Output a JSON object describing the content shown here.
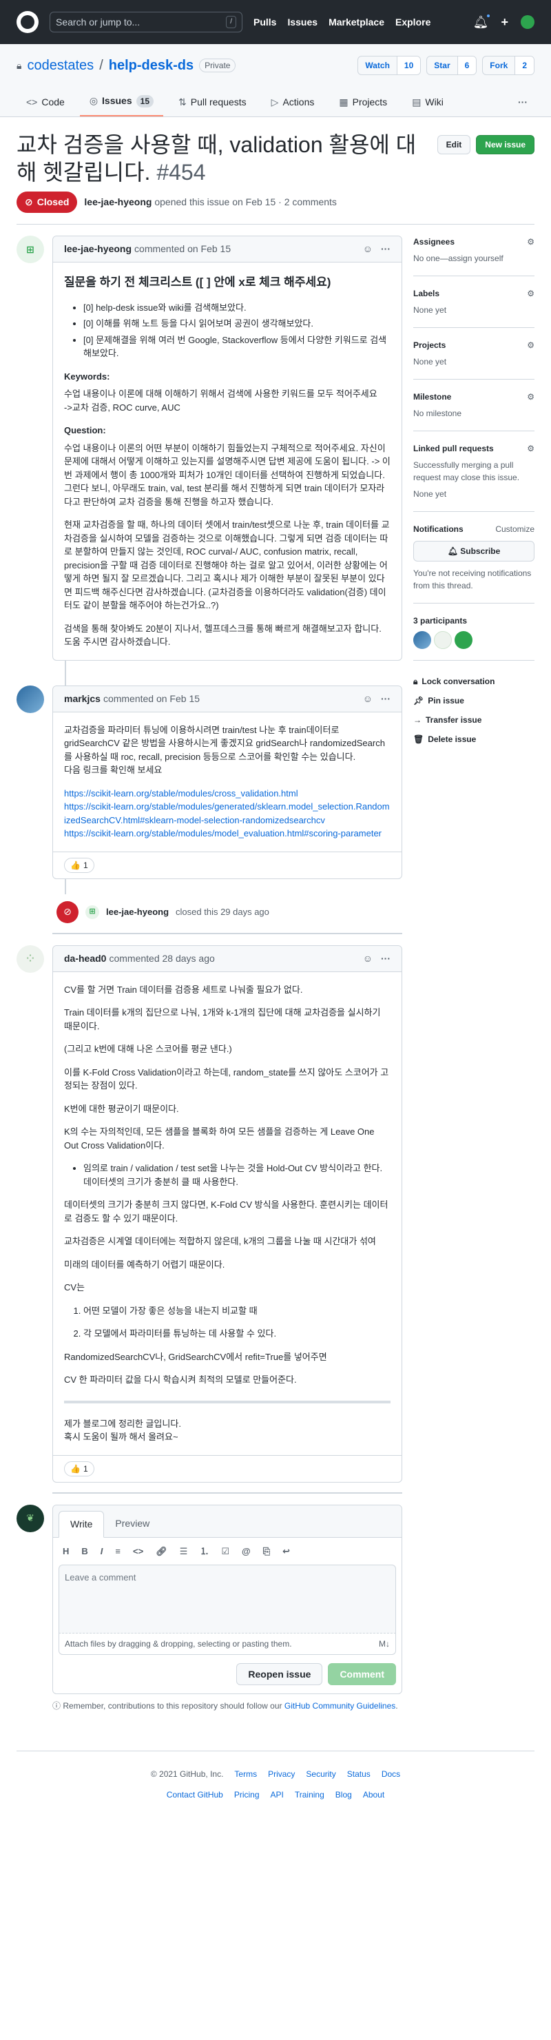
{
  "header": {
    "search_placeholder": "Search or jump to...",
    "slash": "/",
    "nav": [
      "Pulls",
      "Issues",
      "Marketplace",
      "Explore"
    ],
    "plus": "+"
  },
  "repo": {
    "owner": "codestates",
    "name": "help-desk-ds",
    "visibility": "Private",
    "watch_label": "Watch",
    "watch_count": "10",
    "star_label": "Star",
    "star_count": "6",
    "fork_label": "Fork",
    "fork_count": "2"
  },
  "tabs": {
    "code": "Code",
    "issues": "Issues",
    "issues_count": "15",
    "pulls": "Pull requests",
    "actions": "Actions",
    "projects": "Projects",
    "wiki": "Wiki"
  },
  "issue": {
    "title": "교차 검증을 사용할 때, validation 활용에 대해 헷갈립니다.",
    "number": "#454",
    "edit": "Edit",
    "new_issue": "New issue",
    "status": "Closed",
    "author": "lee-jae-hyeong",
    "opened_text": "opened this issue on Feb 15 · 2 comments"
  },
  "comments": [
    {
      "author": "lee-jae-hyeong",
      "time": "commented on Feb 15",
      "heading": "질문을 하기 전 체크리스트 ([ ] 안에 x로 체크 해주세요)",
      "checklist": [
        "[0] help-desk issue와 wiki를 검색해보았다.",
        "[0] 이해를 위해 노트 등을 다시 읽어보며 공권이 생각해보았다.",
        "[0] 문제해결을 위해 여러 번 Google, Stackoverflow 등에서 다양한 키워드로 검색해보았다."
      ],
      "kw_label": "Keywords:",
      "kw_text1": "수업 내용이나 이론에 대해 이해하기 위해서 검색에 사용한 키워드를 모두 적어주세요",
      "kw_text2": "->교차 검증, ROC curve, AUC",
      "q_label": "Question:",
      "q_p1": "수업 내용이나 이론의 어떤 부분이 이해하기 힘들었는지 구체적으로 적어주세요. 자신이 문제에 대해서 어떻게 이해하고 있는지를 설명해주시면 답변 제공에 도움이 됩니다. -> 이번 과제에서 행이 총 1000개와 피처가 10개인 데이터를 선택하여 진행하게 되었습니다. 그런다 보니, 아무래도 train, val, test 분리를 해서 진행하게 되면 train 데이터가 모자라다고 판단하여 교차 검증을 통해 진행을 하고자 했습니다.",
      "q_p2": "현재 교차검증을 할 때, 하나의 데이터 셋에서 train/test셋으로 나눈 후, train 데이터를 교차검증을 실시하여 모델을 검증하는 것으로 이해했습니다. 그렇게 되면 검증 데이터는 따로 분할하여 만들지 않는 것인데, ROC curval-/ AUC, confusion matrix, recall, precision을 구할 때 검증 데이터로 진행해야 하는 걸로 알고 있어서, 이러한 상황에는 어떻게 하면 될지 잘 모르겠습니다. 그리고 혹시나 제가 이해한 부분이 잘못된 부분이 있다면 피드백 해주신다면 감사하겠습니다. (교차검증을 이용하더라도 validation(검증) 데이터도 같이 분할을 해주어야 하는건가요..?)",
      "q_p3": "검색을 통해 찾아봐도 20분이 지나서, 헬프데스크를 통해 빠르게 해결해보고자 합니다. 도움 주시면 감사하겠습니다."
    },
    {
      "author": "markjcs",
      "time": "commented on Feb 15",
      "p1": "교차검증을 파라미터 튜닝에 이용하시려면 train/test 나눈 후 train데이터로 gridSearchCV 같은 방법을 사용하시는게 좋겠지요 gridSearch나 randomizedSearch 를 사용하실 때 roc, recall, precision 등등으로 스코어를 확인할 수는 있습니다.",
      "p2": "다음 링크를 확인해 보세요",
      "links": [
        "https://scikit-learn.org/stable/modules/cross_validation.html",
        "https://scikit-learn.org/stable/modules/generated/sklearn.model_selection.RandomizedSearchCV.html#sklearn-model-selection-randomizedsearchcv",
        "https://scikit-learn.org/stable/modules/model_evaluation.html#scoring-parameter"
      ],
      "reaction": "👍",
      "reaction_count": "1"
    },
    {
      "author": "da-head0",
      "time": "commented 28 days ago",
      "p1": "CV를 할 거면 Train 데이터를 검증용 세트로 나눠줄 필요가 없다.",
      "p2": "Train 데이터를 k개의 집단으로 나눠, 1개와 k-1개의 집단에 대해 교차검증을 실시하기 때문이다.",
      "p3": "(그리고 k번에 대해 나온 스코어를 평균 낸다.)",
      "p4": "이를 K-Fold Cross Validation이라고 하는데, random_state를 쓰지 않아도 스코어가 고정되는 장점이 있다.",
      "p5": "K번에 대한 평균이기 때문이다.",
      "p6": "K의 수는 자의적인데, 모든 샘플을 블록화 하여 모든 샘플을 검증하는 게 Leave One Out Cross Validation이다.",
      "li1": "임의로 train / validation / test set을 나누는 것을 Hold-Out CV 방식이라고 한다.",
      "li1b": "데이터셋의 크기가 충분히 클 때 사용한다.",
      "p7": "데이터셋의 크기가 충분히 크지 않다면, K-Fold CV 방식을 사용한다. 훈련시키는 데이터로 검증도 할 수 있기 때문이다.",
      "p8": "교차검증은 시계열 데이터에는 적합하지 않은데, k개의 그룹을 나눌 때 시간대가 섞여",
      "p9": "미래의 데이터를 예측하기 어렵기 때문이다.",
      "p10": "CV는",
      "ol": [
        "어떤 모델이 가장 좋은 성능을 내는지 비교할 때",
        "각 모델에서 파라미터를 튜닝하는 데 사용할 수 있다."
      ],
      "p11": "RandomizedSearchCV나, GridSearchCV에서 refit=True를 넣어주면",
      "p12": "CV 한 파라미터 값을 다시 학습시켜 최적의 모델로 만들어준다.",
      "p13": "제가 블로그에 정리한 글입니다.",
      "p14": "혹시 도움이 될까 해서 올려요~",
      "reaction": "👍",
      "reaction_count": "1"
    }
  ],
  "event": {
    "actor": "lee-jae-hyeong",
    "text": "closed this 29 days ago"
  },
  "editor": {
    "write": "Write",
    "preview": "Preview",
    "placeholder": "Leave a comment",
    "attach": "Attach files by dragging & dropping, selecting or pasting them.",
    "reopen": "Reopen issue",
    "comment": "Comment",
    "note": "Remember, contributions to this repository should follow our",
    "note_link": "GitHub Community Guidelines",
    "note_end": "."
  },
  "sidebar": {
    "assignees": "Assignees",
    "assignees_val": "No one—assign yourself",
    "labels": "Labels",
    "labels_val": "None yet",
    "projects": "Projects",
    "projects_val": "None yet",
    "milestone": "Milestone",
    "milestone_val": "No milestone",
    "linked": "Linked pull requests",
    "linked_desc": "Successfully merging a pull request may close this issue.",
    "linked_val": "None yet",
    "notifications": "Notifications",
    "customize": "Customize",
    "subscribe": "Subscribe",
    "notif_desc": "You're not receiving notifications from this thread.",
    "participants": "3 participants",
    "lock": "Lock conversation",
    "pin": "Pin issue",
    "transfer": "Transfer issue",
    "delete": "Delete issue"
  },
  "footer": {
    "copyright": "© 2021 GitHub, Inc.",
    "row1": [
      "Terms",
      "Privacy",
      "Security",
      "Status",
      "Docs"
    ],
    "row2": [
      "Contact GitHub",
      "Pricing",
      "API",
      "Training",
      "Blog",
      "About"
    ]
  },
  "colors": {
    "closed": "#cf222e",
    "green": "#2da44e",
    "link": "#0969da"
  }
}
